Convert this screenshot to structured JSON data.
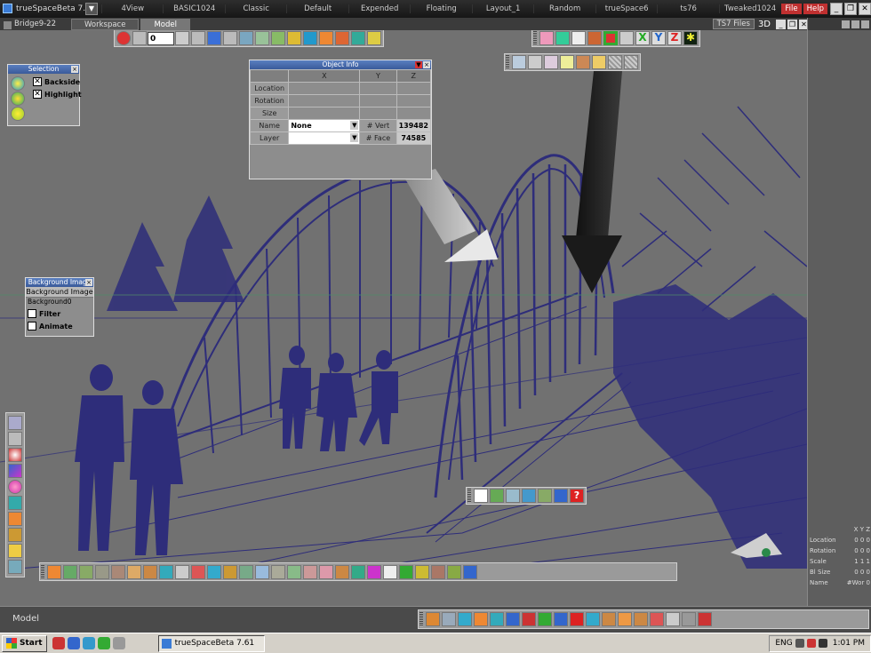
{
  "app": {
    "title": "trueSpaceBeta 7.61",
    "document": "Bridge9-22"
  },
  "layouts": [
    "4View",
    "BASIC1024",
    "Classic",
    "Default",
    "Expended",
    "Floating",
    "Layout_1",
    "Random",
    "trueSpace6",
    "ts76",
    "Tweaked1024"
  ],
  "menus": {
    "file": "File",
    "help": "Help"
  },
  "tabs": [
    {
      "label": "Workspace",
      "active": false
    },
    {
      "label": "Model",
      "active": true
    }
  ],
  "view_controls": {
    "files": "TS7 Files",
    "mode": "3D"
  },
  "playback": {
    "frame": "0"
  },
  "object_info": {
    "title": "Object Info",
    "columns": [
      "X",
      "Y",
      "Z"
    ],
    "rows": [
      "Location",
      "Rotation",
      "Size"
    ],
    "name_label": "Name",
    "name_value": "None",
    "layer_label": "Layer",
    "layer_value": "",
    "verts_label": "# Vert",
    "verts_value": "139482",
    "faces_label": "# Face",
    "faces_value": "74585"
  },
  "selection_panel": {
    "title": "Selection",
    "options": [
      {
        "label": "Backside",
        "checked": true
      },
      {
        "label": "Highlight",
        "checked": true
      }
    ]
  },
  "background_panel": {
    "title": "Background Image",
    "header": "Background Image",
    "file": "Background0",
    "options": [
      {
        "label": "Filter",
        "checked": false
      },
      {
        "label": "Animate",
        "checked": false
      }
    ]
  },
  "side_info": {
    "axes": "X Y Z",
    "rows": [
      {
        "label": "Location",
        "value": "0 0 0"
      },
      {
        "label": "Rotation",
        "value": "0 0 0"
      },
      {
        "label": "Scale",
        "value": "1 1 1"
      },
      {
        "label": "Bl Size",
        "value": "0 0 0"
      },
      {
        "label": "Name",
        "value": "#Wor 0"
      }
    ]
  },
  "model_bar": {
    "label": "Model"
  },
  "taskbar": {
    "start": "Start",
    "task": "trueSpaceBeta 7.61",
    "lang": "ENG",
    "clock": "1:01 PM"
  },
  "colors": {
    "wireframe": "#2e2d7a",
    "viewport_bg": "#717171",
    "accent_red": "#c03030"
  }
}
